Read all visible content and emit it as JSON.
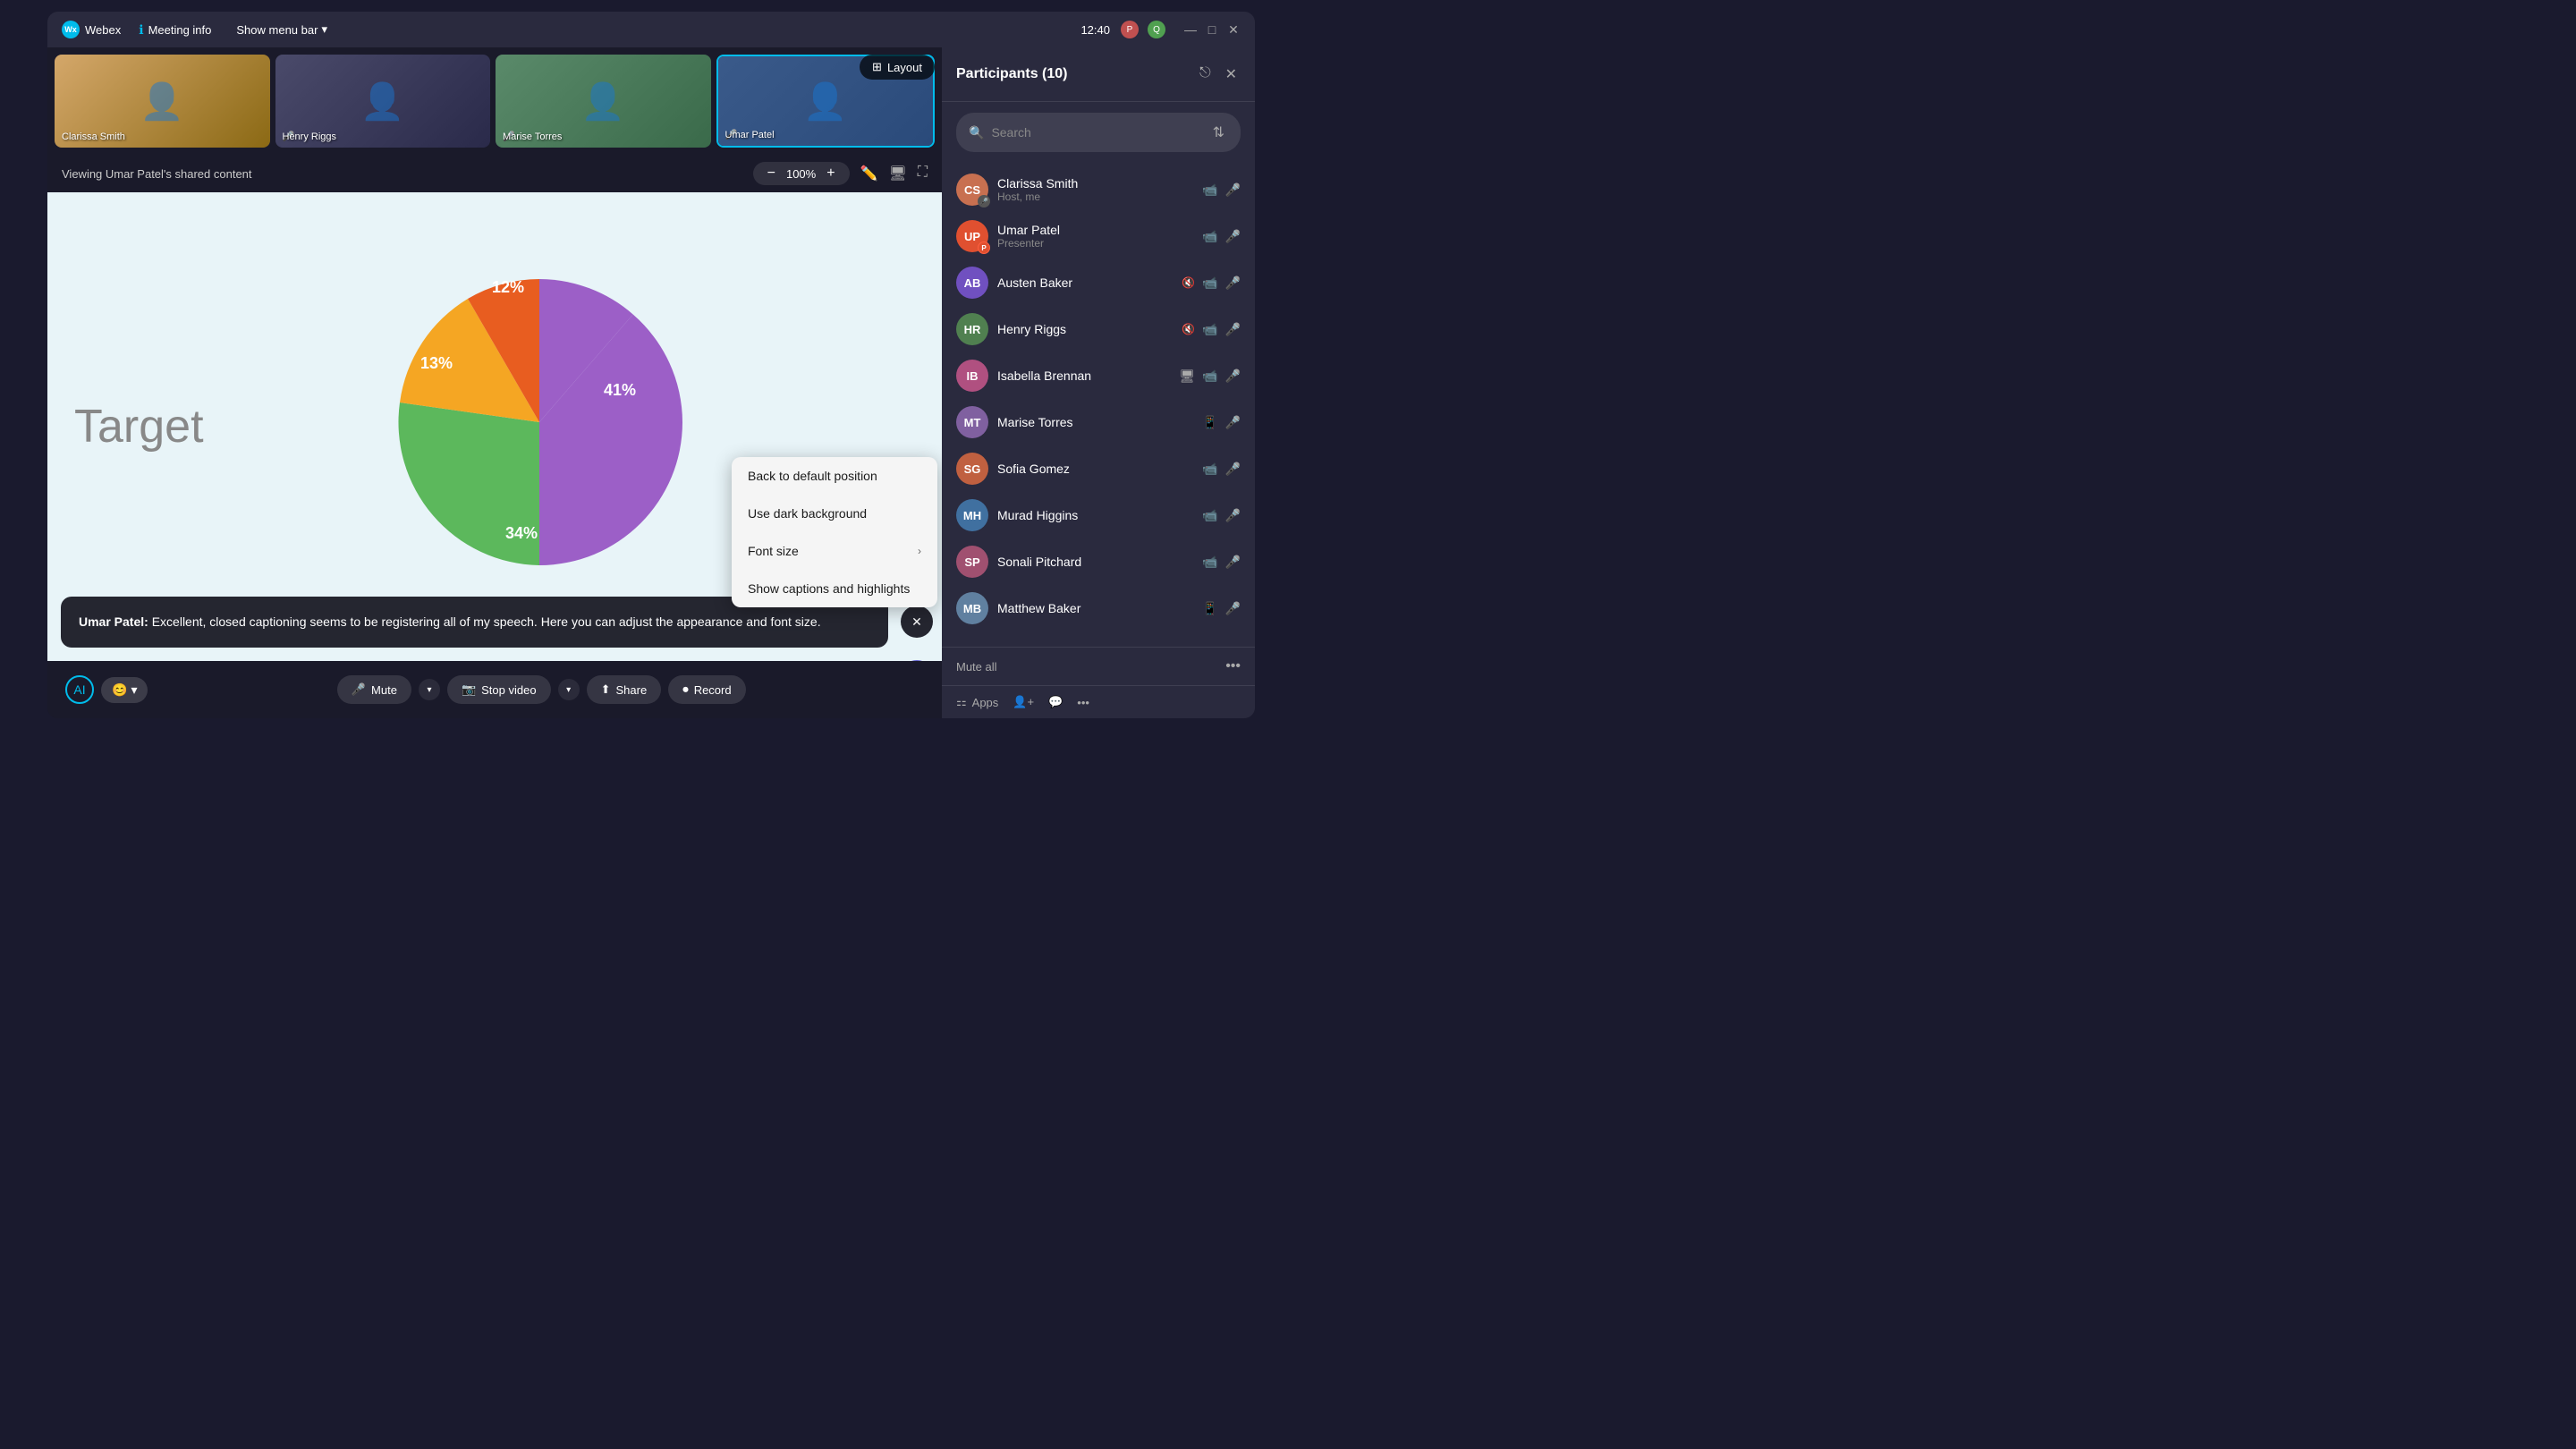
{
  "app": {
    "name": "Webex",
    "time": "12:40"
  },
  "titlebar": {
    "logo": "W",
    "meeting_info": "Meeting info",
    "show_menu": "Show menu bar",
    "window_controls": {
      "minimize": "—",
      "maximize": "□",
      "close": "✕"
    }
  },
  "thumbnails": [
    {
      "name": "Clarissa Smith",
      "color1": "#c8956a",
      "color2": "#8b6014",
      "active": false
    },
    {
      "name": "Henry Riggs",
      "color1": "#4a4a6a",
      "color2": "#2a2a4a",
      "active": false
    },
    {
      "name": "Marise Torres",
      "color1": "#5a8a6a",
      "color2": "#3a6a4a",
      "active": false
    },
    {
      "name": "Umar Patel",
      "color1": "#3a5a8a",
      "color2": "#2a4a7a",
      "active": true
    }
  ],
  "layout_btn": "Layout",
  "viewing_text": "Viewing Umar Patel's shared content",
  "zoom": {
    "minus": "−",
    "value": "100%",
    "plus": "+"
  },
  "pie_chart": {
    "segments": [
      {
        "label": "41%",
        "color": "#9c5fc7",
        "pct": 41
      },
      {
        "label": "34%",
        "color": "#5cb85c",
        "pct": 34
      },
      {
        "label": "13%",
        "color": "#f5a623",
        "pct": 13
      },
      {
        "label": "12%",
        "color": "#e85d20",
        "pct": 12
      }
    ],
    "target_label": "Target"
  },
  "caption": {
    "speaker": "Umar Patel",
    "text": "Excellent, closed captioning seems to be registering all of my speech. Here you can adjust the appearance and font size."
  },
  "context_menu": {
    "items": [
      {
        "label": "Back to default position",
        "has_arrow": false
      },
      {
        "label": "Use dark background",
        "has_arrow": false
      },
      {
        "label": "Font size",
        "has_arrow": true
      },
      {
        "label": "Show captions and highlights",
        "has_arrow": false
      }
    ]
  },
  "toolbar": {
    "mute": "Mute",
    "stop_video": "Stop video",
    "share": "Share",
    "record": "Record"
  },
  "sidebar": {
    "title": "Participants",
    "count": 10,
    "search_placeholder": "Search",
    "participants": [
      {
        "name": "Clarissa Smith",
        "role": "Host, me",
        "avatar_color": "#c87050",
        "video": true,
        "mic": true,
        "muted": false
      },
      {
        "name": "Umar Patel",
        "role": "Presenter",
        "avatar_color": "#e05030",
        "video": true,
        "mic": true,
        "muted": false
      },
      {
        "name": "Austen Baker",
        "role": "",
        "avatar_color": "#7050c0",
        "video": true,
        "mic": false,
        "muted": true
      },
      {
        "name": "Henry Riggs",
        "role": "",
        "avatar_color": "#508050",
        "video": true,
        "mic": false,
        "muted": true
      },
      {
        "name": "Isabella Brennan",
        "role": "",
        "avatar_color": "#b05080",
        "video": true,
        "mic": false,
        "muted": true
      },
      {
        "name": "Marise Torres",
        "role": "",
        "avatar_color": "#8060a0",
        "video": false,
        "mic": false,
        "muted": true
      },
      {
        "name": "Sofia Gomez",
        "role": "",
        "avatar_color": "#c06040",
        "video": true,
        "mic": true,
        "muted": false
      },
      {
        "name": "Murad Higgins",
        "role": "",
        "avatar_color": "#4070a0",
        "video": true,
        "mic": false,
        "muted": true
      },
      {
        "name": "Sonali Pitchard",
        "role": "",
        "avatar_color": "#a05070",
        "video": true,
        "mic": false,
        "muted": true
      },
      {
        "name": "Matthew Baker",
        "role": "",
        "avatar_color": "#6080a0",
        "video": false,
        "mic": false,
        "muted": true
      }
    ],
    "mute_all": "Mute all",
    "apps": "Apps"
  }
}
